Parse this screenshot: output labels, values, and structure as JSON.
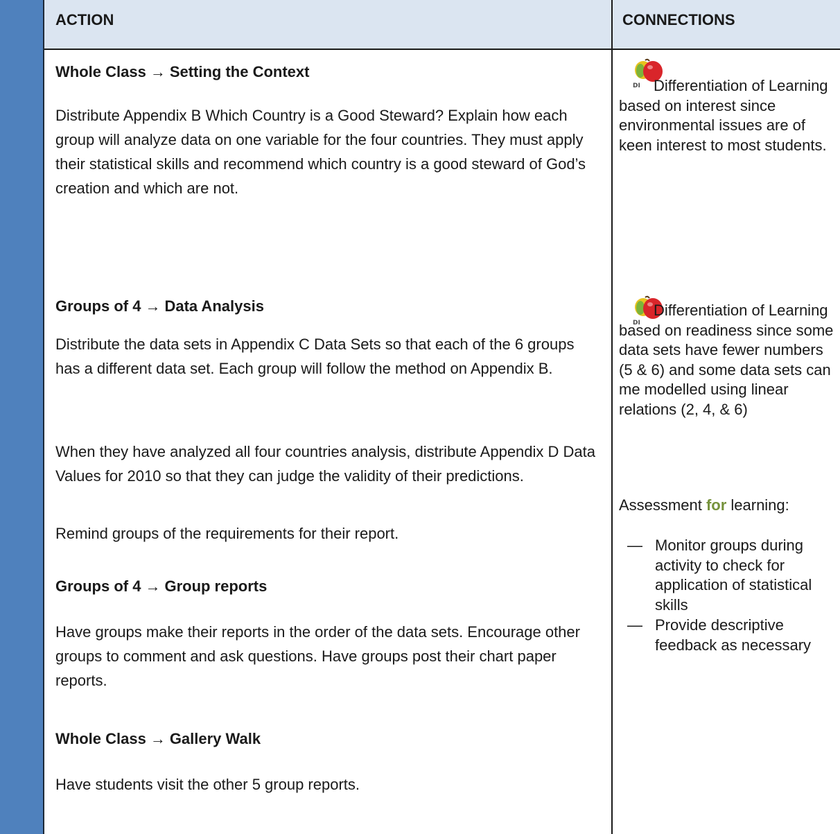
{
  "header": {
    "action_label": "ACTION",
    "connections_label": "CONNECTIONS"
  },
  "action": {
    "section1": {
      "mode": "Whole Class",
      "arrow": "→",
      "title": "Setting the Context",
      "paragraph": "Distribute Appendix B Which Country is a Good Steward?  Explain how each group will analyze data on one variable for the four countries.  They must apply their statistical skills and recommend which country is a good steward of God’s creation and which are not."
    },
    "section2": {
      "mode": "Groups of 4",
      "arrow": "→",
      "title": "Data Analysis",
      "paragraph1": "Distribute the data sets in Appendix C Data Sets so that each of the 6 groups has a different data set.  Each group will follow the method on Appendix B.",
      "paragraph2": "When they have analyzed all four countries analysis, distribute Appendix D Data Values for 2010 so that they can judge the validity of their predictions.",
      "paragraph3": "Remind groups of the requirements for their report."
    },
    "section3": {
      "mode": "Groups of 4",
      "arrow": "→",
      "title": "Group reports",
      "paragraph": "Have groups make their reports in the order of the data sets. Encourage other groups to comment and ask questions. Have groups post their chart paper reports."
    },
    "section4": {
      "mode": "Whole Class",
      "arrow": "→",
      "title": "Gallery Walk",
      "paragraph": "Have students visit the other 5 group reports."
    }
  },
  "connections": {
    "di_badge": "DI",
    "di1": {
      "text": "Differentiation of Learning based on interest since environmental issues are of keen interest to most students."
    },
    "di2": {
      "text": "Differentiation of Learning based on readiness since some data sets have fewer numbers (5 & 6) and some data sets can me modelled using linear relations (2, 4, & 6)"
    },
    "assessment": {
      "prefix": "Assessment ",
      "highlight": "for",
      "suffix": " learning:",
      "highlight_color": "#76923c"
    },
    "bullets": [
      {
        "dash": "—",
        "text": "Monitor groups during activity to check for application of statistical skills"
      },
      {
        "dash": "—",
        "text": "Provide descriptive feedback as necessary"
      }
    ]
  },
  "colors": {
    "sidebar": "#4f81bd",
    "header_bg": "#dbe5f1",
    "rule": "#1a1a1a"
  }
}
